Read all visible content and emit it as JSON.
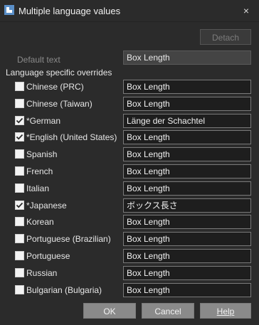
{
  "window": {
    "title": "Multiple language values",
    "close_icon": "×"
  },
  "detach_label": "Detach",
  "default_text": {
    "label": "Default text",
    "value": "Box Length"
  },
  "overrides_heading": "Language specific overrides",
  "languages": [
    {
      "name": "Chinese (PRC)",
      "checked": false,
      "value": "Box Length"
    },
    {
      "name": "Chinese (Taiwan)",
      "checked": false,
      "value": "Box Length"
    },
    {
      "name": "*German",
      "checked": true,
      "value": "Länge der Schachtel"
    },
    {
      "name": "*English (United States)",
      "checked": true,
      "value": "Box Length"
    },
    {
      "name": "Spanish",
      "checked": false,
      "value": "Box Length"
    },
    {
      "name": "French",
      "checked": false,
      "value": "Box Length"
    },
    {
      "name": "Italian",
      "checked": false,
      "value": "Box Length"
    },
    {
      "name": "*Japanese",
      "checked": true,
      "value": "ボックス長さ"
    },
    {
      "name": "Korean",
      "checked": false,
      "value": "Box Length"
    },
    {
      "name": "Portuguese (Brazilian)",
      "checked": false,
      "value": "Box Length"
    },
    {
      "name": "Portuguese",
      "checked": false,
      "value": "Box Length"
    },
    {
      "name": "Russian",
      "checked": false,
      "value": "Box Length"
    },
    {
      "name": "Bulgarian (Bulgaria)",
      "checked": false,
      "value": "Box Length"
    }
  ],
  "buttons": {
    "ok": "OK",
    "cancel": "Cancel",
    "help": "Help"
  },
  "colors": {
    "background": "#2b2b2b",
    "button": "#8a8a8a",
    "field": "#1e1e1e"
  }
}
